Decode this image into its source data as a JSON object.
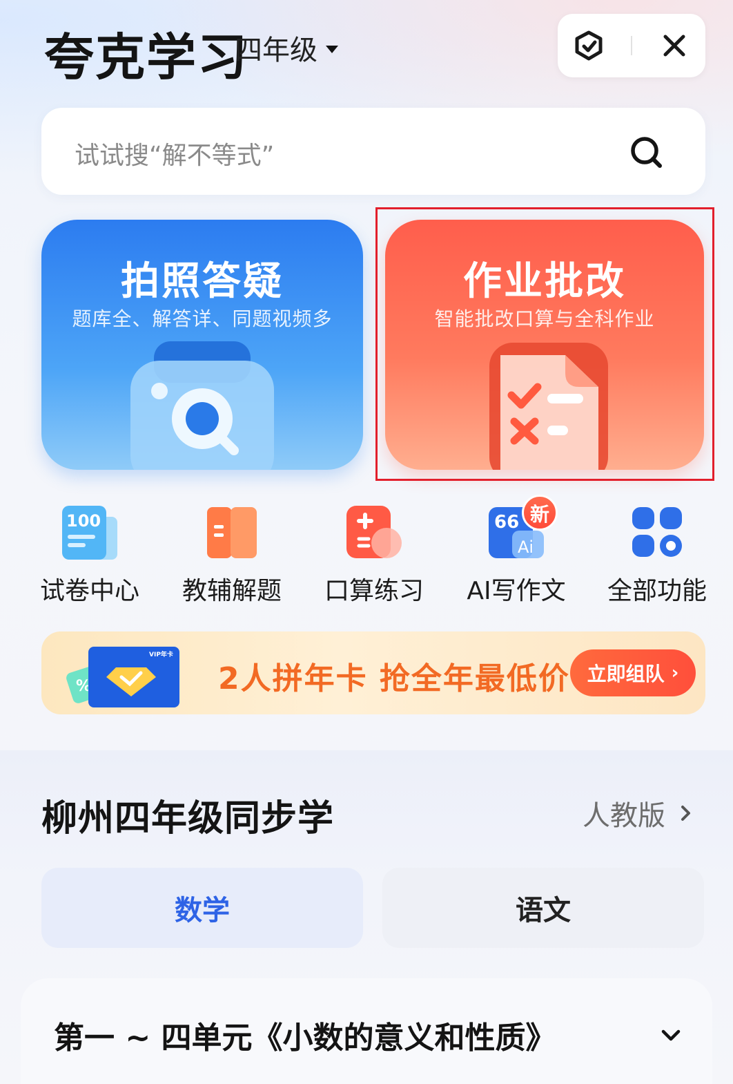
{
  "header": {
    "app_title": "夸克学习",
    "grade": "四年级",
    "capsule_icons": [
      "cube-check-icon",
      "close-icon"
    ]
  },
  "search": {
    "placeholder": "试试搜“解不等式”"
  },
  "cards": {
    "photo": {
      "title": "拍照答疑",
      "subtitle": "题库全、解答详、同题视频多"
    },
    "homework": {
      "title": "作业批改",
      "subtitle": "智能批改口算与全科作业"
    }
  },
  "tools": [
    {
      "label": "试卷中心",
      "icon": "exam-100-icon"
    },
    {
      "label": "教辅解题",
      "icon": "book-icon"
    },
    {
      "label": "口算练习",
      "icon": "calculator-icon"
    },
    {
      "label": "AI写作文",
      "icon": "ai-quote-icon",
      "badge": "新"
    },
    {
      "label": "全部功能",
      "icon": "grid-apps-icon"
    }
  ],
  "promo": {
    "text": "2人拼年卡 抢全年最低价",
    "button": "立即组队",
    "vip_tag": "VIP年卡"
  },
  "sync": {
    "title": "柳州四年级同步学",
    "edition": "人教版",
    "tabs": [
      "数学",
      "语文"
    ],
    "active_tab": "数学",
    "unit_title": "第一 ~ 四单元《小数的意义和性质》"
  },
  "colors": {
    "accent_blue": "#2e63e6",
    "photo_card": "#2c7cf0",
    "homework_card": "#ff5e4c",
    "promo_orange": "#f26a24",
    "highlight_red": "#e21f2c"
  }
}
